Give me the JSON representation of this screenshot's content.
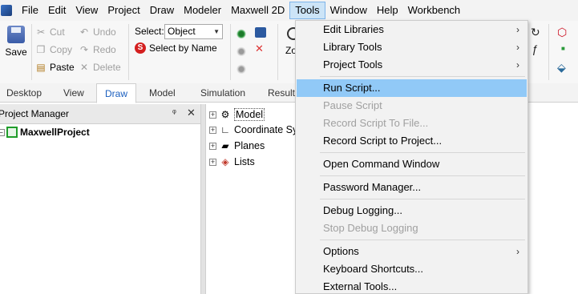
{
  "menubar": {
    "items": [
      "File",
      "Edit",
      "View",
      "Project",
      "Draw",
      "Modeler",
      "Maxwell 2D",
      "Tools",
      "Window",
      "Help",
      "Workbench"
    ],
    "active": "Tools"
  },
  "ribbon": {
    "save": "Save",
    "cut": "Cut",
    "copy": "Copy",
    "paste": "Paste",
    "undo": "Undo",
    "redo": "Redo",
    "delete": "Delete",
    "select_label": "Select:",
    "select_value": "Object",
    "select_by_name": "Select by Name",
    "zoom_partial": "Zo"
  },
  "tabs": [
    "Desktop",
    "View",
    "Draw",
    "Model",
    "Simulation",
    "Result"
  ],
  "active_tab": "Draw",
  "project_manager": {
    "title": "Project Manager",
    "project": "MaxwellProject"
  },
  "tree": {
    "items": [
      "Model",
      "Coordinate Systems",
      "Planes",
      "Lists"
    ]
  },
  "tools_menu": {
    "items": [
      {
        "label": "Edit Libraries",
        "submenu": true,
        "enabled": true
      },
      {
        "label": "Library Tools",
        "submenu": true,
        "enabled": true
      },
      {
        "label": "Project Tools",
        "submenu": true,
        "enabled": true
      },
      {
        "label": "Run Script...",
        "submenu": false,
        "enabled": true,
        "highlighted": true
      },
      {
        "label": "Pause Script",
        "submenu": false,
        "enabled": false
      },
      {
        "label": "Record Script To File...",
        "submenu": false,
        "enabled": false
      },
      {
        "label": "Record Script to Project...",
        "submenu": false,
        "enabled": true
      },
      {
        "label": "Open Command Window",
        "submenu": false,
        "enabled": true
      },
      {
        "label": "Password Manager...",
        "submenu": false,
        "enabled": true
      },
      {
        "label": "Debug Logging...",
        "submenu": false,
        "enabled": true
      },
      {
        "label": "Stop Debug Logging",
        "submenu": false,
        "enabled": false
      },
      {
        "label": "Options",
        "submenu": true,
        "enabled": true
      },
      {
        "label": "Keyboard Shortcuts...",
        "submenu": false,
        "enabled": true
      },
      {
        "label": "External Tools...",
        "submenu": false,
        "enabled": true
      }
    ]
  },
  "colors": {
    "menu_highlight": "#91c9f7",
    "active_menu_bg": "#cce4f7",
    "active_tab_text": "#1b5fbf",
    "project_icon": "#1f9d2a"
  }
}
